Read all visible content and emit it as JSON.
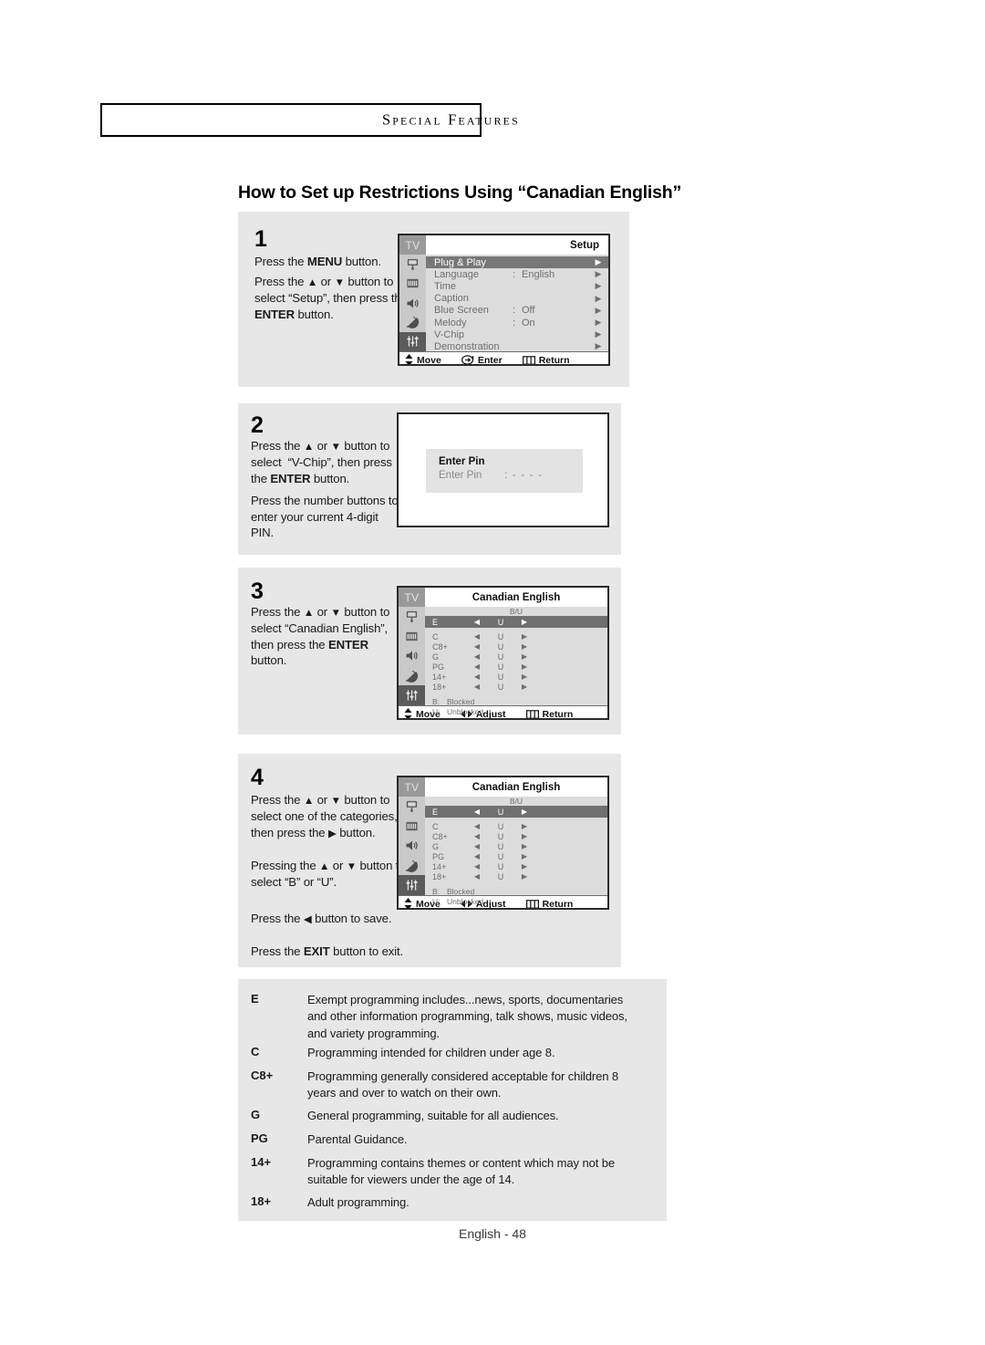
{
  "header": {
    "section_label": "Special Features",
    "page_title": "How to Set up Restrictions Using “Canadian English”"
  },
  "footer": {
    "page_label": "English - 48"
  },
  "steps": [
    {
      "number": "1",
      "lines": [
        "Press the MENU button.",
        "Press the ▲ or ▼ button to select “Setup”, then press the ENTER button."
      ]
    },
    {
      "number": "2",
      "lines": [
        "Press the ▲ or ▼ button to select  “V-Chip”, then press the ENTER button.",
        "Press the number buttons to enter your current 4-digit PIN."
      ]
    },
    {
      "number": "3",
      "lines": [
        "Press the ▲ or ▼ button to select “Canadian English”, then press the ENTER button."
      ]
    },
    {
      "number": "4",
      "lines": [
        "Press the ▲ or ▼ button to select one of the categories, then press the ▶ button.",
        "Pressing the ▲ or ▼ button to select “B” or “U”.",
        "Press the ◀ button to save.",
        "Press the EXIT button to exit."
      ]
    }
  ],
  "setup_menu": {
    "tv_tag": "TV",
    "title": "Setup",
    "rows": [
      {
        "label": "Plug & Play",
        "colon": "",
        "value": "",
        "arrow": "▶",
        "selected": true
      },
      {
        "label": "Language",
        "colon": ":",
        "value": "English",
        "arrow": "▶",
        "selected": false
      },
      {
        "label": "Time",
        "colon": "",
        "value": "",
        "arrow": "▶",
        "selected": false
      },
      {
        "label": "Caption",
        "colon": "",
        "value": "",
        "arrow": "▶",
        "selected": false
      },
      {
        "label": "Blue Screen",
        "colon": ":",
        "value": "Off",
        "arrow": "▶",
        "selected": false
      },
      {
        "label": "Melody",
        "colon": ":",
        "value": "On",
        "arrow": "▶",
        "selected": false
      },
      {
        "label": "V-Chip",
        "colon": "",
        "value": "",
        "arrow": "▶",
        "selected": false
      },
      {
        "label": "Demonstration",
        "colon": "",
        "value": "",
        "arrow": "▶",
        "selected": false
      }
    ],
    "footer": {
      "move": "Move",
      "enter": "Enter",
      "return": "Return"
    }
  },
  "pin_dialog": {
    "title": "Enter Pin",
    "field_label": "Enter Pin",
    "field_value": ": - - - -"
  },
  "canadian_english": {
    "tv_tag": "TV",
    "title": "Canadian English",
    "column_header": "B/U",
    "rows": [
      {
        "label": "E",
        "left": "◀",
        "value": "U",
        "right": "▶",
        "selected": true
      },
      {
        "label": "C",
        "left": "◀",
        "value": "U",
        "right": "▶",
        "selected": false
      },
      {
        "label": "C8+",
        "left": "◀",
        "value": "U",
        "right": "▶",
        "selected": false
      },
      {
        "label": "G",
        "left": "◀",
        "value": "U",
        "right": "▶",
        "selected": false
      },
      {
        "label": "PG",
        "left": "◀",
        "value": "U",
        "right": "▶",
        "selected": false
      },
      {
        "label": "14+",
        "left": "◀",
        "value": "U",
        "right": "▶",
        "selected": false
      },
      {
        "label": "18+",
        "left": "◀",
        "value": "U",
        "right": "▶",
        "selected": false
      }
    ],
    "legend": [
      {
        "key": "B:",
        "text": "Blocked"
      },
      {
        "key": "U:",
        "text": "Unblocked"
      }
    ],
    "footer": {
      "move": "Move",
      "adjust": "Adjust",
      "return": "Return"
    }
  },
  "rating_legend": [
    {
      "code": "E",
      "desc": "Exempt programming includes...news, sports, documentaries and other information programming, talk shows, music videos, and variety programming."
    },
    {
      "code": "C",
      "desc": "Programming intended for children under age 8."
    },
    {
      "code": "C8+",
      "desc": "Programming generally considered acceptable for children 8 years and over to watch on their own."
    },
    {
      "code": "G",
      "desc": "General programming, suitable for all audiences."
    },
    {
      "code": "PG",
      "desc": "Parental Guidance."
    },
    {
      "code": "14+",
      "desc": "Programming contains themes or content which may not be suitable for viewers under the age of 14."
    },
    {
      "code": "18+",
      "desc": "Adult programming."
    }
  ],
  "colors": {
    "panel_bg": "#e7e7e7",
    "osd_bg": "#dcdcdc",
    "osd_highlight": "#777777",
    "osd_rail": "#c9c9c9",
    "osd_rail_active": "#5b5b5b"
  }
}
